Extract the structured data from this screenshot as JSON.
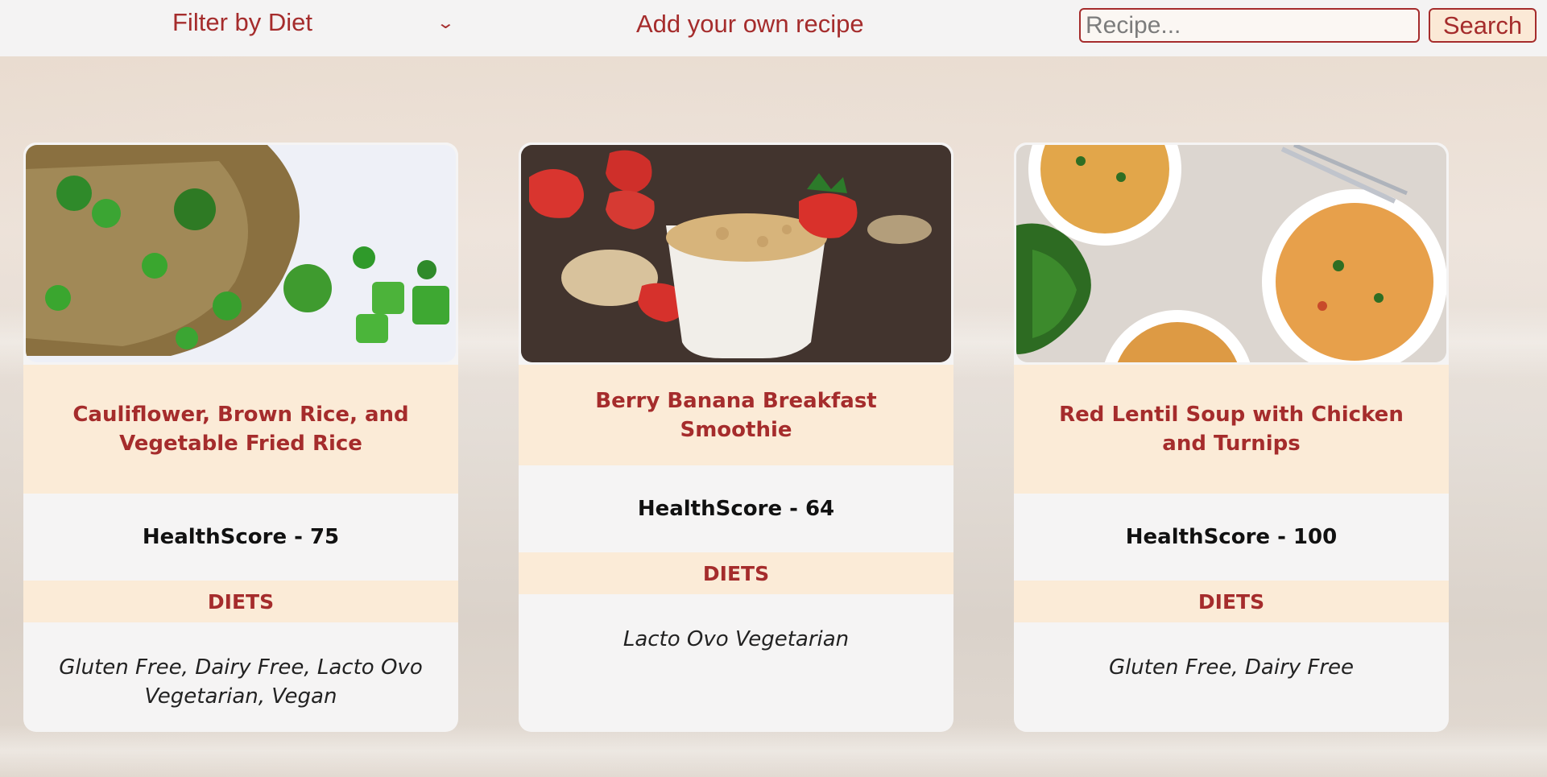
{
  "nav": {
    "filter_label": "Filter by Diet",
    "add_recipe_label": "Add your own recipe",
    "search_placeholder": "Recipe...",
    "search_button_label": "Search"
  },
  "recipes": [
    {
      "title": "Cauliflower, Brown Rice, and Vegetable Fried Rice",
      "health_score": "HealthScore - 75",
      "diets_heading": "DIETS",
      "diets": "Gluten Free, Dairy Free, Lacto Ovo Vegetarian, Vegan"
    },
    {
      "title": "Berry Banana Breakfast Smoothie",
      "health_score": "HealthScore - 64",
      "diets_heading": "DIETS",
      "diets": "Lacto Ovo Vegetarian"
    },
    {
      "title": "Red Lentil Soup with Chicken and Turnips",
      "health_score": "HealthScore - 100",
      "diets_heading": "DIETS",
      "diets": "Gluten Free, Dairy Free"
    }
  ],
  "colors": {
    "accent": "#a52c2c",
    "card_band": "#fbebd7",
    "card_body": "#f5f4f4",
    "topbar": "#f4f3f3"
  }
}
